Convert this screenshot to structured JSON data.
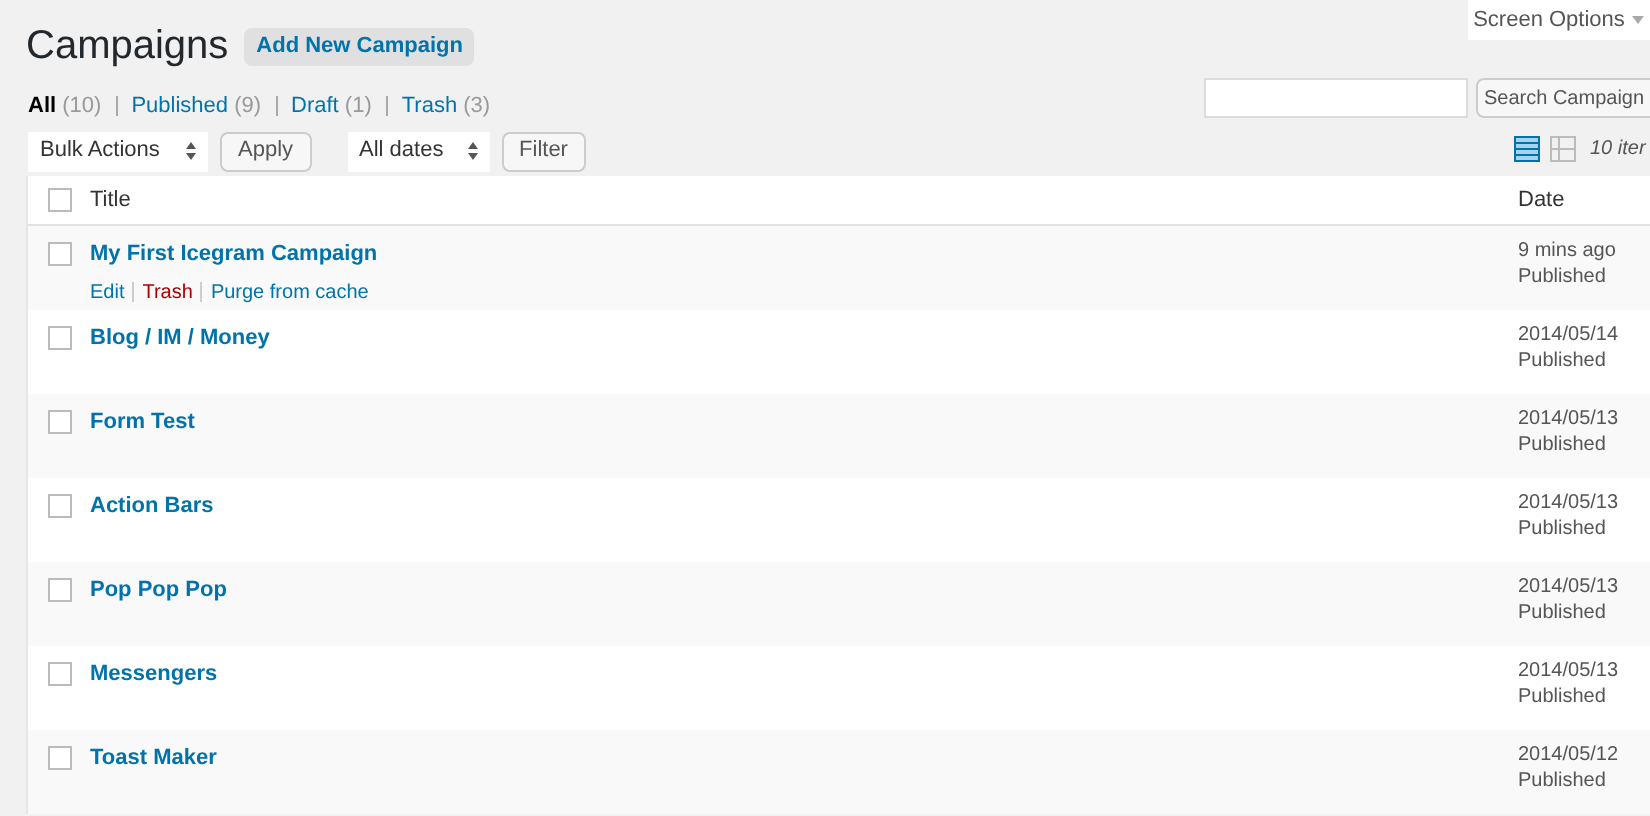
{
  "header": {
    "title": "Campaigns",
    "add_button": "Add New Campaign",
    "screen_options": "Screen Options"
  },
  "filters": [
    {
      "label": "All",
      "count": "(10)",
      "selected": true
    },
    {
      "label": "Published",
      "count": "(9)",
      "selected": false
    },
    {
      "label": "Draft",
      "count": "(1)",
      "selected": false
    },
    {
      "label": "Trash",
      "count": "(3)",
      "selected": false
    }
  ],
  "toolbar": {
    "bulk_actions": "Bulk Actions",
    "apply": "Apply",
    "dates": "All dates",
    "filter": "Filter",
    "search_button": "Search Campaign",
    "view_modes": [
      {
        "kind": "list",
        "selected": true
      },
      {
        "kind": "excerpt",
        "selected": false
      }
    ],
    "count": "10 iter"
  },
  "table": {
    "select_all_checked": false,
    "columns": [
      "Title",
      "Date"
    ],
    "rows": [
      {
        "title": "My First Icegram Campaign",
        "date": "9 mins ago",
        "status": "Published",
        "checked": false,
        "actions": [
          {
            "label": "Edit",
            "kind": "normal"
          },
          {
            "label": "Trash",
            "kind": "danger"
          },
          {
            "label": "Purge from cache",
            "kind": "normal"
          }
        ]
      },
      {
        "title": "Blog / IM / Money",
        "date": "2014/05/14",
        "status": "Published",
        "checked": false
      },
      {
        "title": "Form Test",
        "date": "2014/05/13",
        "status": "Published",
        "checked": false
      },
      {
        "title": "Action Bars",
        "date": "2014/05/13",
        "status": "Published",
        "checked": false
      },
      {
        "title": "Pop Pop Pop",
        "date": "2014/05/13",
        "status": "Published",
        "checked": false
      },
      {
        "title": "Messengers",
        "date": "2014/05/13",
        "status": "Published",
        "checked": false
      },
      {
        "title": "Toast Maker",
        "date": "2014/05/12",
        "status": "Published",
        "checked": false
      }
    ]
  }
}
